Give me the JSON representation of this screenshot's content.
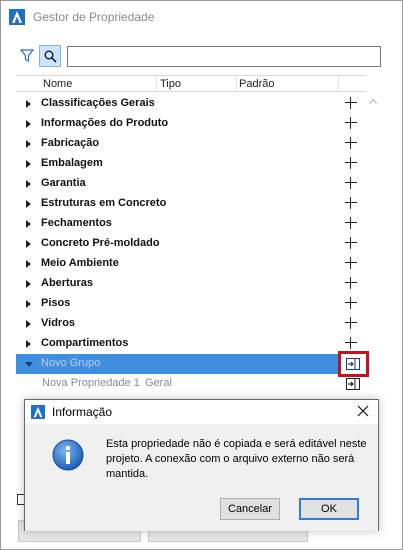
{
  "window": {
    "title": "Gestor de Propriedade"
  },
  "search": {
    "value": "",
    "placeholder": ""
  },
  "table": {
    "columns": [
      "Nome",
      "Tipo",
      "Padrão"
    ],
    "groups": [
      "Classificações Gerais",
      "Informações do Produto",
      "Fabricação",
      "Embalagem",
      "Garantia",
      "Estruturas em Concreto",
      "Fechamentos",
      "Concreto Pré-moldado",
      "Meio Ambiente",
      "Aberturas",
      "Pisos",
      "Vidros",
      "Compartimentos"
    ],
    "selected_group": "Novo Grupo",
    "property": {
      "name": "Nova Propriedade 1",
      "type": "Geral"
    }
  },
  "dialog": {
    "title": "Informação",
    "message": "Esta propriedade não é copiada e será editável neste projeto. A conexão com o arquivo externo não será mantida.",
    "cancel_label": "Cancelar",
    "ok_label": "OK"
  },
  "colors": {
    "selection": "#3f8ee0",
    "highlight": "#c0141e",
    "accent": "#2f7bd6"
  }
}
